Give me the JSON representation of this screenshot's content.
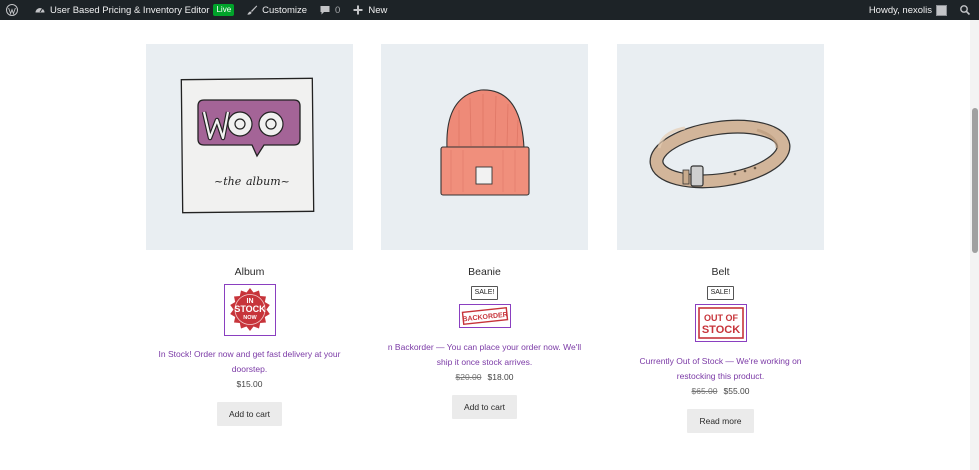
{
  "adminbar": {
    "site_name": "User Based Pricing & Inventory Editor",
    "live_badge": "Live",
    "customize": "Customize",
    "comments_count": "0",
    "new": "New",
    "howdy": "Howdy, nexolis"
  },
  "products": [
    {
      "title": "Album",
      "sale_badge": "",
      "stamp_text": [
        "IN",
        "STOCK",
        "NOW"
      ],
      "stock_message": "In Stock! Order now and get fast delivery at your doorstep.",
      "price_old": "",
      "price": "$15.00",
      "button": "Add to cart"
    },
    {
      "title": "Beanie",
      "sale_badge": "SALE!",
      "stamp_text": [
        "BACKORDER"
      ],
      "stock_message": "n Backorder — You can place your order now. We'll ship it once stock arrives.",
      "price_old": "$20.00",
      "price": "$18.00",
      "button": "Add to cart"
    },
    {
      "title": "Belt",
      "sale_badge": "SALE!",
      "stamp_text": [
        "OUT OF",
        "STOCK"
      ],
      "stock_message": "Currently Out of Stock — We're working on restocking this product.",
      "price_old": "$65.00",
      "price": "$55.00",
      "button": "Read more"
    }
  ],
  "colors": {
    "adminbar_bg": "#1d2327",
    "product_bg": "#e9eef2",
    "stock_text": "#7b3aa6",
    "stamp_red": "#c7343a",
    "stamp_border": "#8a3fc0",
    "live_green": "#00a32a"
  },
  "icons": {
    "wordpress": "wordpress-logo-icon",
    "dashboard": "dashboard-gauge-icon",
    "customize": "paintbrush-icon",
    "comments": "comment-bubble-icon",
    "new": "plus-icon",
    "search": "search-icon"
  }
}
